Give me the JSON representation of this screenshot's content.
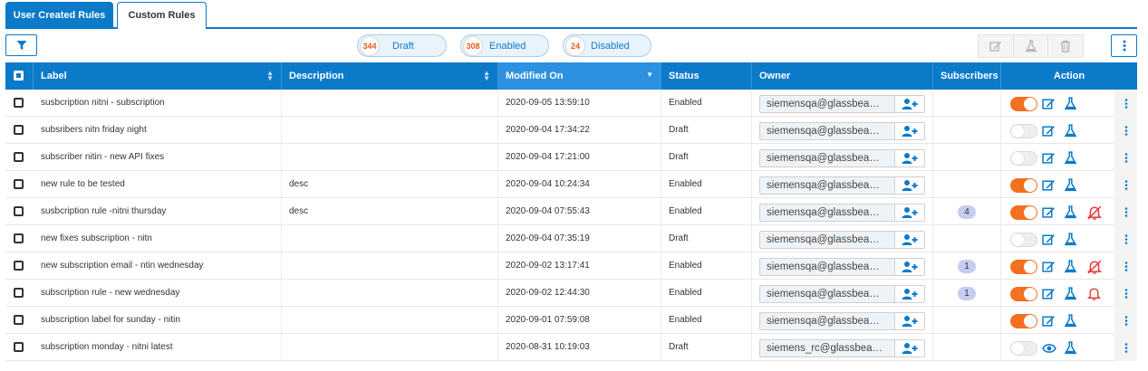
{
  "tabs": [
    {
      "label": "User Created Rules",
      "active": true
    },
    {
      "label": "Custom Rules",
      "active": false
    }
  ],
  "filters": {
    "draft": {
      "count": "344",
      "label": "Draft"
    },
    "enabled": {
      "count": "308",
      "label": "Enabled"
    },
    "disabled": {
      "count": "24",
      "label": "Disabled"
    }
  },
  "columns": {
    "label": "Label",
    "description": "Description",
    "modified": "Modified On",
    "status": "Status",
    "owner": "Owner",
    "subscribers": "Subscribers",
    "action": "Action"
  },
  "rows": [
    {
      "label": "susbcription nitni - subscription",
      "description": "",
      "modified": "2020-09-05 13:59:10",
      "status": "Enabled",
      "owner": "siemensqa@glassbea…",
      "subscribers": "",
      "enabled": true,
      "extra_icon": "none",
      "view_icon": "edit"
    },
    {
      "label": "subsribers nitn friday night",
      "description": "",
      "modified": "2020-09-04 17:34:22",
      "status": "Draft",
      "owner": "siemensqa@glassbea…",
      "subscribers": "",
      "enabled": false,
      "extra_icon": "none",
      "view_icon": "edit"
    },
    {
      "label": "subscriber nitin - new API fixes",
      "description": "",
      "modified": "2020-09-04 17:21:00",
      "status": "Draft",
      "owner": "siemensqa@glassbea…",
      "subscribers": "",
      "enabled": false,
      "extra_icon": "none",
      "view_icon": "edit"
    },
    {
      "label": "new rule to be tested",
      "description": "desc",
      "modified": "2020-09-04 10:24:34",
      "status": "Enabled",
      "owner": "siemensqa@glassbea…",
      "subscribers": "",
      "enabled": true,
      "extra_icon": "none",
      "view_icon": "edit"
    },
    {
      "label": "susbcription rule -nitni thursday",
      "description": "desc",
      "modified": "2020-09-04 07:55:43",
      "status": "Enabled",
      "owner": "siemensqa@glassbea…",
      "subscribers": "4",
      "enabled": true,
      "extra_icon": "bell-off",
      "view_icon": "edit"
    },
    {
      "label": "new fixes subscription - nitn",
      "description": "",
      "modified": "2020-09-04 07:35:19",
      "status": "Draft",
      "owner": "siemensqa@glassbea…",
      "subscribers": "",
      "enabled": false,
      "extra_icon": "none",
      "view_icon": "edit"
    },
    {
      "label": "new subscription email - ntin wednesday",
      "description": "",
      "modified": "2020-09-02 13:17:41",
      "status": "Enabled",
      "owner": "siemensqa@glassbea…",
      "subscribers": "1",
      "enabled": true,
      "extra_icon": "bell-off",
      "view_icon": "edit"
    },
    {
      "label": "subscription rule - new wednesday",
      "description": "",
      "modified": "2020-09-02 12:44:30",
      "status": "Enabled",
      "owner": "siemensqa@glassbea…",
      "subscribers": "1",
      "enabled": true,
      "extra_icon": "bell",
      "view_icon": "edit"
    },
    {
      "label": "subscription label for sunday - nitin",
      "description": "",
      "modified": "2020-09-01 07:59:08",
      "status": "Enabled",
      "owner": "siemensqa@glassbea…",
      "subscribers": "",
      "enabled": true,
      "extra_icon": "none",
      "view_icon": "edit"
    },
    {
      "label": "subscription monday - nitni latest",
      "description": "",
      "modified": "2020-08-31 10:19:03",
      "status": "Draft",
      "owner": "siemens_rc@glassbea…",
      "subscribers": "",
      "enabled": false,
      "extra_icon": "none",
      "view_icon": "eye"
    }
  ],
  "colors": {
    "primary": "#0b7ac9",
    "toggle_on": "#f37021",
    "alert": "#e53935",
    "badge": "#c6cdf2"
  }
}
